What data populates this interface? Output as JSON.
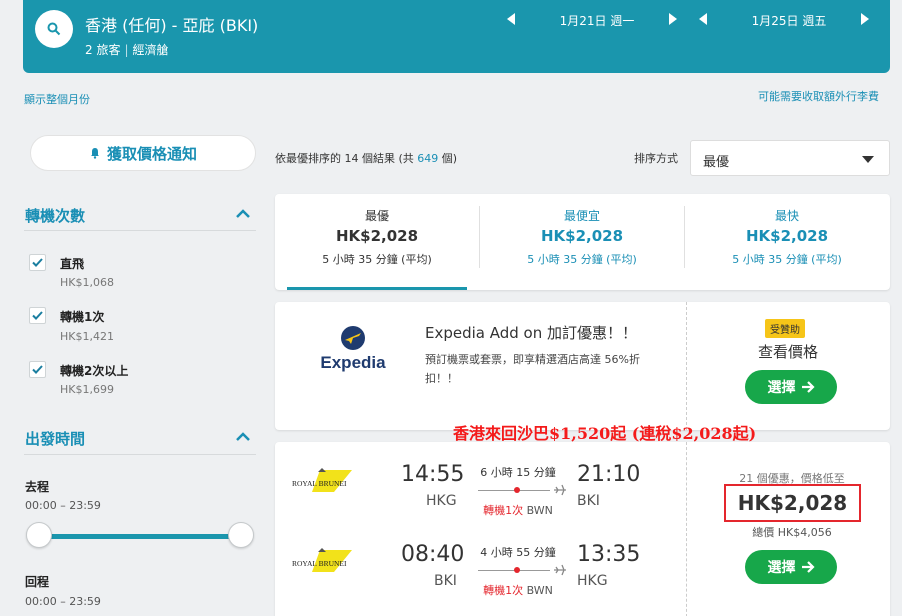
{
  "header": {
    "route": "香港 (任何) - 亞庇 (BKI)",
    "travelers": "2 旅客",
    "cabin": "經濟艙",
    "depart_date": "1月21日 週一",
    "return_date": "1月25日 週五"
  },
  "links": {
    "show_month": "顯示整個月份",
    "extra_fees": "可能需要收取額外行李費"
  },
  "sidebar": {
    "alert_button": "獲取價格通知",
    "stops_title": "轉機次數",
    "stops": [
      {
        "label": "直飛",
        "price": "HK$1,068"
      },
      {
        "label": "轉機1次",
        "price": "HK$1,421"
      },
      {
        "label": "轉機2次以上",
        "price": "HK$1,699"
      }
    ],
    "times_title": "出發時間",
    "outbound_label": "去程",
    "outbound_range": "00:00 – 23:59",
    "return_label": "回程",
    "return_range": "00:00 – 23:59"
  },
  "results": {
    "summary_prefix": "依最優排序的 14 個結果 (共 ",
    "summary_count": "649",
    "summary_suffix": " 個)",
    "sort_label": "排序方式",
    "sort_value": "最優"
  },
  "tabs": [
    {
      "title": "最優",
      "price": "HK$2,028",
      "duration": "5 小時 35 分鐘 (平均)"
    },
    {
      "title": "最便宜",
      "price": "HK$2,028",
      "duration": "5 小時 35 分鐘 (平均)"
    },
    {
      "title": "最快",
      "price": "HK$2,028",
      "duration": "5 小時 35 分鐘 (平均)"
    }
  ],
  "ad": {
    "brand": "Expedia",
    "title": "Expedia Add on 加訂優惠！！",
    "desc": "預訂機票或套票，即享精選酒店高達 56%折扣！！",
    "badge": "受贊助",
    "view_price": "查看價格",
    "select": "選擇"
  },
  "promo_text": "香港來回沙巴$1,520起 (連稅$2,028起)",
  "flight": {
    "airline_logo": "ROYAL BRUNEI",
    "outbound": {
      "depart_time": "14:55",
      "arrive_time": "21:10",
      "from": "HKG",
      "to": "BKI",
      "duration": "6 小時 15 分鐘",
      "stops": "轉機1次",
      "via": "BWN"
    },
    "return": {
      "depart_time": "08:40",
      "arrive_time": "13:35",
      "from": "BKI",
      "to": "HKG",
      "duration": "4 小時 55 分鐘",
      "stops": "轉機1次",
      "via": "BWN"
    },
    "deals": "21 個優惠，價格低至",
    "price": "HK$2,028",
    "total": "總價 HK$4,056",
    "select": "選擇"
  },
  "colors": {
    "primary": "#1a96ad",
    "link": "#1a8fb5",
    "green": "#17a74a",
    "red": "#e4262d"
  }
}
